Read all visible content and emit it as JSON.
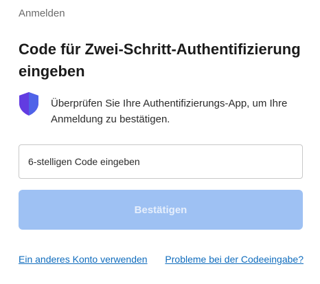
{
  "header": {
    "breadcrumb": "Anmelden",
    "title": "Code für Zwei-Schritt-Authentifizierung eingeben"
  },
  "info": {
    "icon": "shield-icon",
    "text": "Überprüfen Sie Ihre Authentifizierungs-App, um Ihre Anmeldung zu bestätigen."
  },
  "form": {
    "code_placeholder": "6-stelligen Code eingeben",
    "code_value": "",
    "confirm_label": "Bestätigen"
  },
  "links": {
    "other_account": "Ein anderes Konto verwenden",
    "code_problems": "Probleme bei der Codeeingabe?"
  },
  "colors": {
    "button_disabled": "#9ec1f3",
    "link": "#0f6cbd",
    "shield_front": "#4f63e8",
    "shield_back": "#8a2be2"
  }
}
